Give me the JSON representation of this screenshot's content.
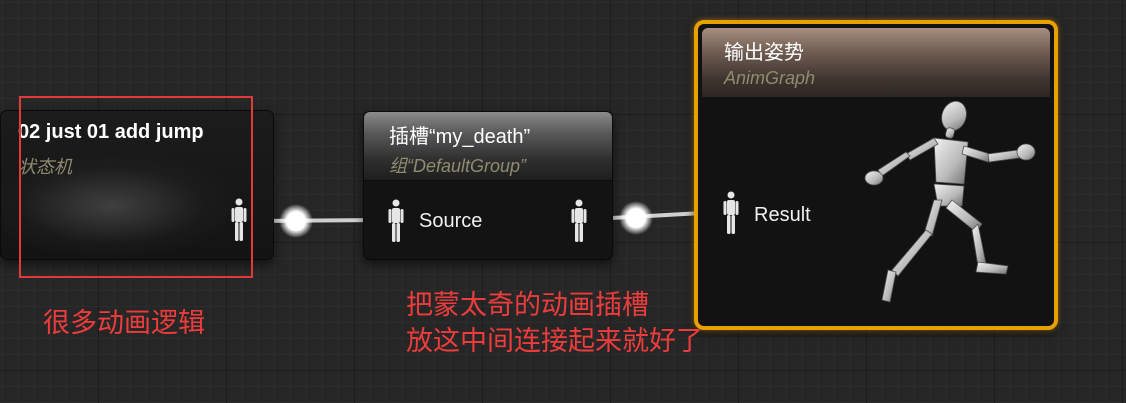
{
  "state_machine_node": {
    "title": "02 just 01 add jump",
    "subtitle": "状态机",
    "output_pin_icon": "pose-figure-icon"
  },
  "slot_node": {
    "title": "插槽“my_death”",
    "subtitle": "组“DefaultGroup”",
    "input_pin_label": "Source",
    "pin_icon": "pose-figure-icon"
  },
  "output_pose_node": {
    "title": "输出姿势",
    "subtitle": "AnimGraph",
    "input_pin_label": "Result",
    "pin_icon": "pose-figure-icon",
    "preview_icon": "mannequin-running-icon"
  },
  "annotations": {
    "left_note": "很多动画逻辑",
    "center_note_line1": "把蒙太奇的动画插槽",
    "center_note_line2": "放这中间连接起来就好了"
  },
  "colors": {
    "graph_background": "#262626",
    "output_node_border": "#e8a000",
    "annotation_red": "#ee3c3c",
    "wire": "#ffffff"
  }
}
